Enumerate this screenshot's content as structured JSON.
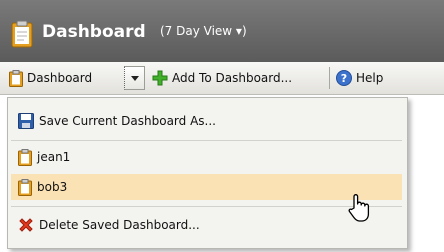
{
  "header": {
    "title": "Dashboard",
    "view_label": "(7 Day View ▾)",
    "icon": "clipboard-icon"
  },
  "toolbar": {
    "dashboard_label": "Dashboard",
    "add_label": "Add To Dashboard...",
    "help_label": "Help"
  },
  "menu": {
    "save_label": "Save Current Dashboard As...",
    "saved_dashboards": [
      "jean1",
      "bob3"
    ],
    "highlighted_item": "bob3",
    "delete_label": "Delete Saved Dashboard..."
  },
  "colors": {
    "header_bg": "#666666",
    "toolbar_bg": "#ecebe6",
    "menu_bg": "#f3f3f0",
    "hover_bg": "#fbe2b4"
  }
}
